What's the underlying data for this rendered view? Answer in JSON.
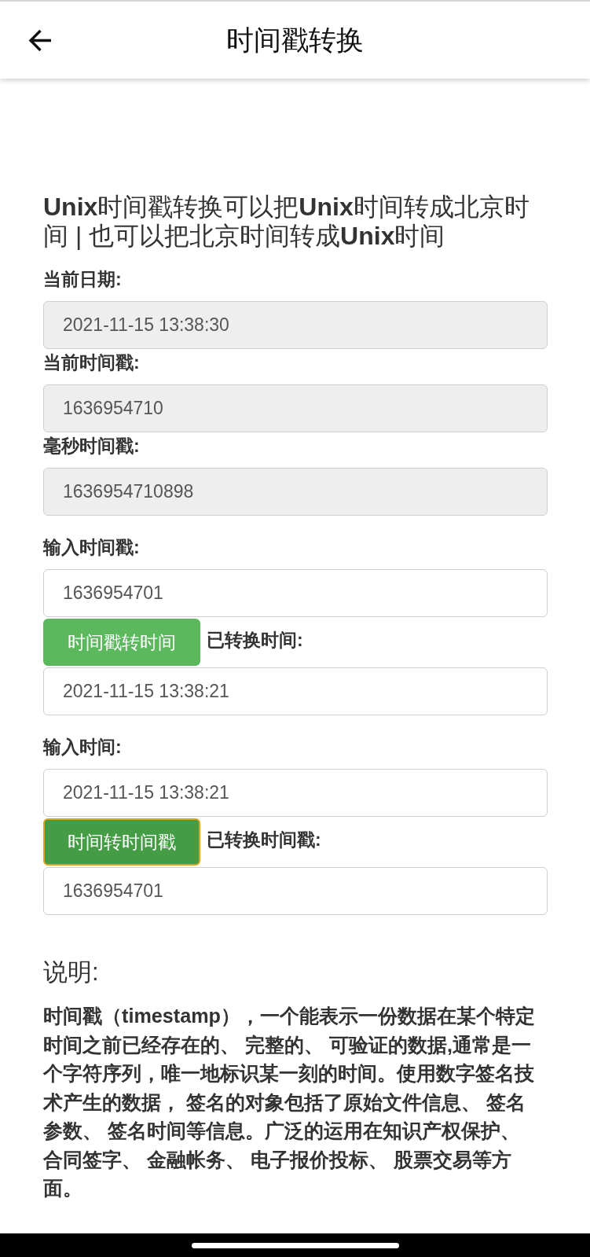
{
  "header": {
    "title": "时间戳转换"
  },
  "intro": "**Unix**时间戳转换可以把**Unix**时间转成北京时间 | 也可以把北京时间转成**Unix**时间",
  "groups": [
    {
      "rows": [
        {
          "kind": "label",
          "text": "当前日期:"
        },
        {
          "kind": "field",
          "value": "2021-11-15 13:38:30",
          "readonly": true
        },
        {
          "kind": "label",
          "text": "当前时间戳:"
        },
        {
          "kind": "field",
          "value": "1636954710",
          "readonly": true
        },
        {
          "kind": "label",
          "text": "毫秒时间戳:"
        },
        {
          "kind": "field",
          "value": "1636954710898",
          "readonly": true
        }
      ]
    },
    {
      "rows": [
        {
          "kind": "label",
          "text": "输入时间戳:"
        },
        {
          "kind": "field",
          "value": "1636954701",
          "readonly": false
        },
        {
          "kind": "action",
          "button": "时间戳转时间",
          "focused": false,
          "label": "已转换时间:"
        },
        {
          "kind": "field",
          "value": "2021-11-15 13:38:21",
          "readonly": false
        }
      ]
    },
    {
      "rows": [
        {
          "kind": "label",
          "text": "输入时间:"
        },
        {
          "kind": "field",
          "value": "2021-11-15 13:38:21",
          "readonly": false
        },
        {
          "kind": "action",
          "button": "时间转时间戳",
          "focused": true,
          "label": "已转换时间戳:"
        },
        {
          "kind": "field",
          "value": "1636954701",
          "readonly": false
        }
      ]
    }
  ],
  "notes": {
    "heading": "说明:",
    "text": "时间戳（timestamp），一个能表示一份数据在某个特定时间之前已经存在的、 完整的、 可验证的数据,通常是一个字符序列，唯一地标识某一刻的时间。使用数字签名技术产生的数据， 签名的对象包括了原始文件信息、 签名参数、 签名时间等信息。广泛的运用在知识产权保护、合同签字、 金融帐务、 电子报价投标、 股票交易等方面。"
  }
}
